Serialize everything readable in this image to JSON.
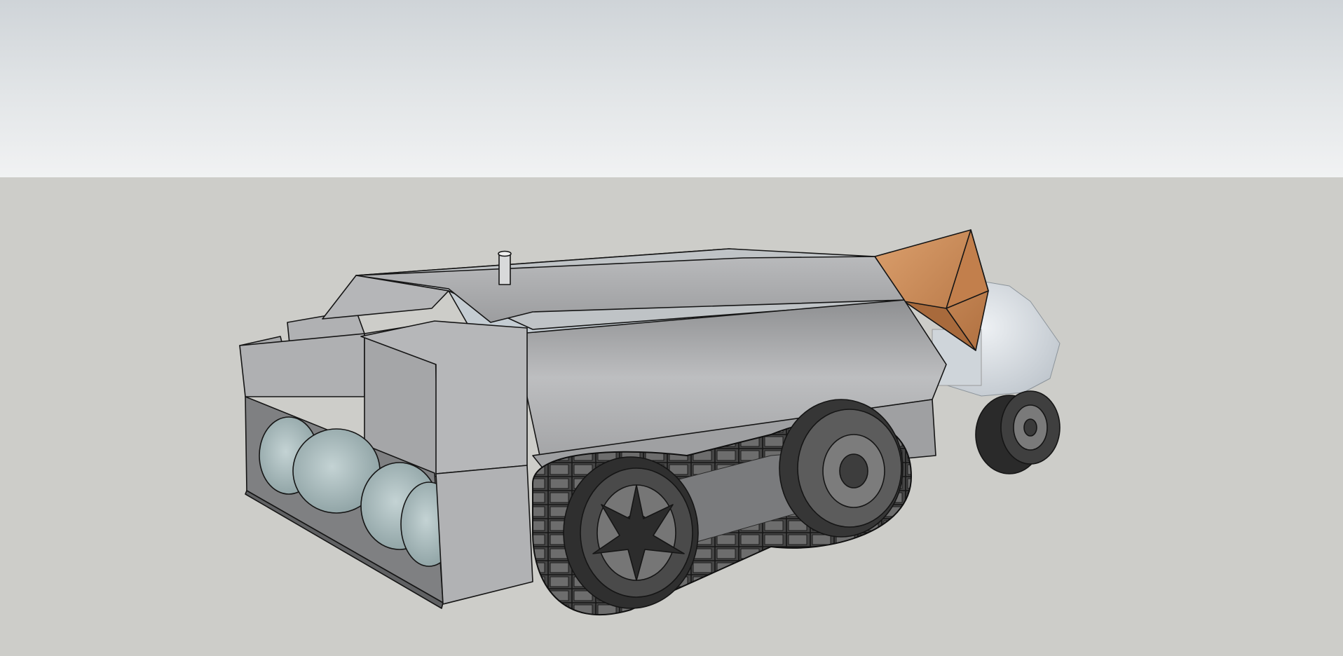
{
  "scene": {
    "sky_color_top": "#cfd4d8",
    "sky_color_bottom": "#f1f2f3",
    "ground_color": "#cdcdc9",
    "model": {
      "body_color": "#a9aaac",
      "glass_color": "#c4ccd2",
      "tank_color": "#9fb2b4",
      "track_color": "#3c3c3c",
      "accent_color": "#c98a55",
      "disc_color": "#d6dbe0"
    }
  }
}
